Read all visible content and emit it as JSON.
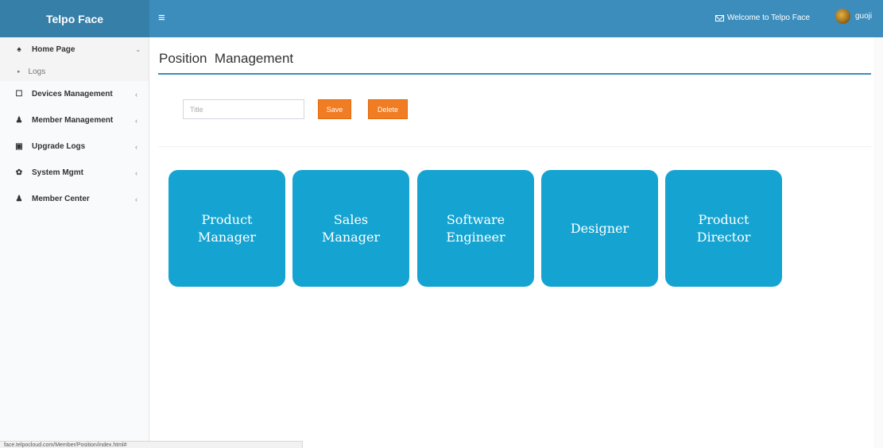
{
  "header": {
    "brand": "Telpo Face",
    "menu_icon": "hamburger-icon",
    "welcome_text": "Welcome to Telpo Face",
    "username": "guoji"
  },
  "sidebar": {
    "items": [
      {
        "label": "Home Page",
        "icon": "home-icon",
        "arrow": "⌄"
      },
      {
        "label": "Devices Management",
        "icon": "device-icon",
        "arrow": "‹"
      },
      {
        "label": "Member Management",
        "icon": "user-icon",
        "arrow": "‹"
      },
      {
        "label": "Upgrade Logs",
        "icon": "file-icon",
        "arrow": "‹"
      },
      {
        "label": "System Mgmt",
        "icon": "gear-icon",
        "arrow": "‹"
      },
      {
        "label": "Member Center",
        "icon": "user-icon",
        "arrow": "‹"
      }
    ],
    "sub_items": [
      {
        "label": "Logs"
      }
    ]
  },
  "main": {
    "page_title": "Position  Management",
    "title_placeholder": "Title",
    "save_label": "Save",
    "delete_label": "Delete",
    "positions": [
      {
        "label": "Product\nManager"
      },
      {
        "label": "Sales\nManager"
      },
      {
        "label": "Software\nEngineer"
      },
      {
        "label": "Designer"
      },
      {
        "label": "Product\nDirector"
      }
    ]
  },
  "status_bar": {
    "url": "face.telpocloud.com/Member/Position/index.html#"
  },
  "colors": {
    "header": "#3c8dbc",
    "brand": "#367fa9",
    "tile": "#15a4d1",
    "button": "#f07c24"
  }
}
